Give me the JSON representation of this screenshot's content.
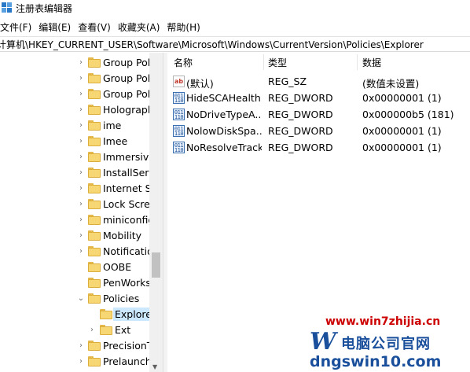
{
  "window": {
    "title": "注册表编辑器"
  },
  "menu": {
    "items": [
      {
        "label": "文件(F)"
      },
      {
        "label": "编辑(E)"
      },
      {
        "label": "查看(V)"
      },
      {
        "label": "收藏夹(A)"
      },
      {
        "label": "帮助(H)"
      }
    ]
  },
  "address": {
    "path": "计算机\\HKEY_CURRENT_USER\\Software\\Microsoft\\Windows\\CurrentVersion\\Policies\\Explorer"
  },
  "tree": {
    "items": [
      {
        "label": "Group Pol",
        "expander": "›"
      },
      {
        "label": "Group Pol",
        "expander": "›"
      },
      {
        "label": "Group Pol",
        "expander": "›"
      },
      {
        "label": "Holographi",
        "expander": "›"
      },
      {
        "label": "ime",
        "expander": "›"
      },
      {
        "label": "Imee",
        "expander": "›"
      },
      {
        "label": "Immersive",
        "expander": "›"
      },
      {
        "label": "InstallServ",
        "expander": "›"
      },
      {
        "label": "Internet Se",
        "expander": "›"
      },
      {
        "label": "Lock Scree",
        "expander": "›"
      },
      {
        "label": "miniconfig",
        "expander": "›"
      },
      {
        "label": "Mobility",
        "expander": "›"
      },
      {
        "label": "Notificatio",
        "expander": "›"
      },
      {
        "label": "OOBE",
        "expander": ""
      },
      {
        "label": "PenWorks",
        "expander": ""
      },
      {
        "label": "Policies",
        "expander": "⌄"
      },
      {
        "label": "Explore",
        "expander": ""
      },
      {
        "label": "Ext",
        "expander": "›"
      },
      {
        "label": "PrecisionT",
        "expander": "›"
      },
      {
        "label": "Prelaunch",
        "expander": "›"
      }
    ]
  },
  "list": {
    "columns": {
      "name": "名称",
      "type": "类型",
      "data": "数据"
    },
    "rows": [
      {
        "icon": "string-value-icon",
        "name": "(默认)",
        "type": "REG_SZ",
        "data": "(数值未设置)"
      },
      {
        "icon": "dword-value-icon",
        "name": "HideSCAHealth",
        "type": "REG_DWORD",
        "data": "0x00000001 (1)"
      },
      {
        "icon": "dword-value-icon",
        "name": "NoDriveTypeA...",
        "type": "REG_DWORD",
        "data": "0x000000b5 (181)"
      },
      {
        "icon": "dword-value-icon",
        "name": "NolowDiskSpa...",
        "type": "REG_DWORD",
        "data": "0x00000001 (1)"
      },
      {
        "icon": "dword-value-icon",
        "name": "NoResolveTrack",
        "type": "REG_DWORD",
        "data": "0x00000001 (1)"
      }
    ]
  },
  "watermark": {
    "url": "www.win7zhijia.cn",
    "logo_letter": "W",
    "brand": "电脑公司官网",
    "domain": "dngswin10.com"
  },
  "colors": {
    "selection": "#cce8ff",
    "folder": "#f7d774",
    "watermark_red": "#cc0000",
    "watermark_blue": "#1a4f9c"
  }
}
